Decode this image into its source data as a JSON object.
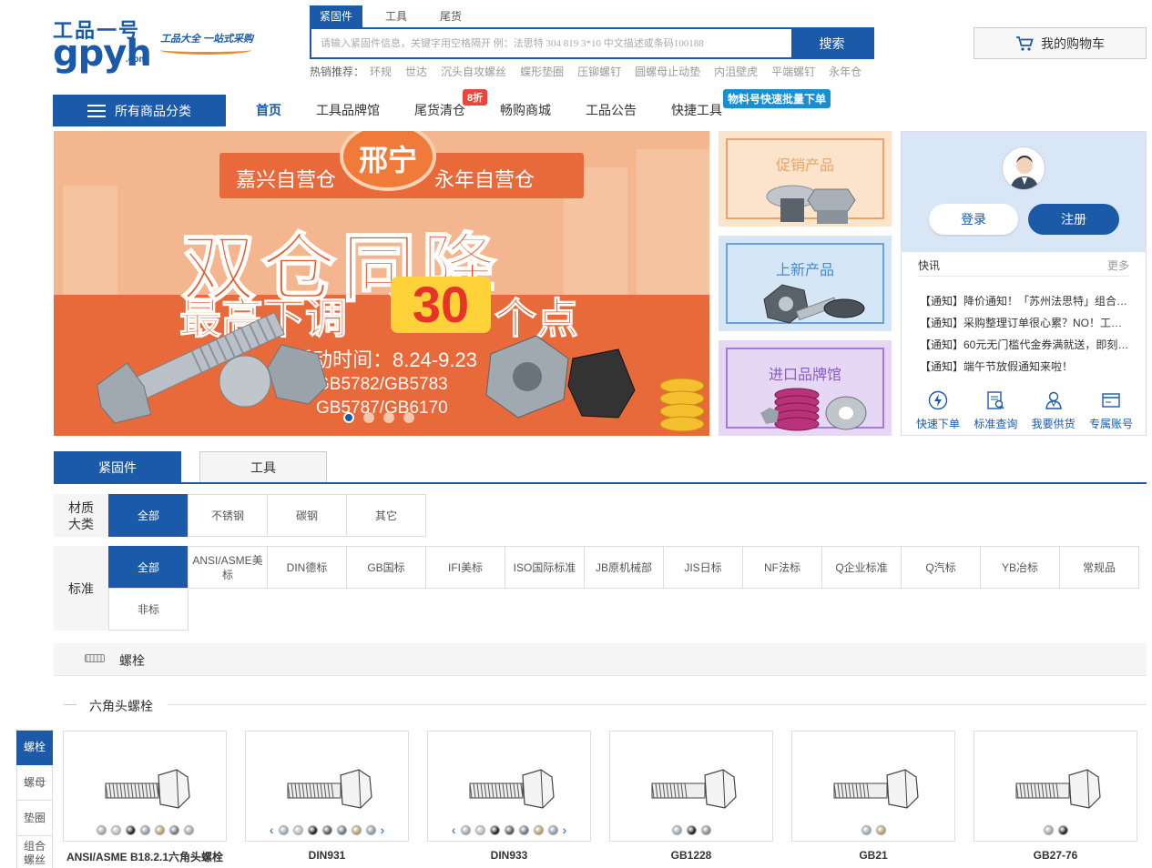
{
  "logo": {
    "cn": "工品一号",
    "en": "gpyh",
    "com": ".com",
    "slogan": "工品大全 一站式采购"
  },
  "search": {
    "tabs": [
      "紧固件",
      "工具",
      "尾货"
    ],
    "active_tab": "紧固件",
    "placeholder": "请输入紧固件信息，关键字用空格隔开 例：法思特 304 819 3*10 中文描述或条码100188",
    "button": "搜索",
    "hot_label": "热销推荐：",
    "hot_items": [
      "环规",
      "世达",
      "沉头自攻螺丝",
      "蝶形垫圈",
      "压铆螺钉",
      "圆螺母止动垫",
      "内沮壁虎",
      "平端螺钉",
      "永年仓"
    ]
  },
  "cart": {
    "label": "我的购物车",
    "icon": "cart-icon"
  },
  "nav": {
    "all_categories": "所有商品分类",
    "items": [
      "首页",
      "工具品牌馆",
      "尾货清仓",
      "畅购商城",
      "工品公告",
      "快捷工具"
    ],
    "active": "首页",
    "badge_discount": "8折",
    "badge_bulk": "物料号快速批量下单"
  },
  "banner": {
    "ribbon_left": "嘉兴自营仓",
    "ribbon_center": "邢宁",
    "ribbon_right": "永年自营仓",
    "title": "双仓同降",
    "sub_prefix": "最高下调",
    "sub_number": "30",
    "sub_suffix": "个点",
    "activity_time": "活动时间：8.24-9.23",
    "standards": [
      "GB5782/GB5783",
      "GB5787/GB6170"
    ],
    "slides": 4,
    "active_slide": 1
  },
  "promos": [
    {
      "title": "促销产品",
      "bg": "#fbe3cc",
      "border": "#e8a46a",
      "color": "#e8a46a"
    },
    {
      "title": "上新产品",
      "bg": "#d5e6f7",
      "border": "#6aa3d8",
      "color": "#4a8ac8"
    },
    {
      "title": "进口品牌馆",
      "bg": "#e6d8f5",
      "border": "#a57ad8",
      "color": "#8a5ac0"
    }
  ],
  "user": {
    "login": "登录",
    "register": "注册",
    "news_title": "快讯",
    "news_more": "更多",
    "news": [
      "【通知】降价通知！「苏州法思特」组合…",
      "【通知】采购整理订单很心累？NO！工…",
      "【通知】60元无门槛代金券满就送，即刻…",
      "【通知】端午节放假通知来啦！"
    ],
    "quick": [
      {
        "label": "快速下单",
        "icon": "lightning-icon"
      },
      {
        "label": "标准查询",
        "icon": "document-search-icon"
      },
      {
        "label": "我要供货",
        "icon": "supplier-icon"
      },
      {
        "label": "专属账号",
        "icon": "account-card-icon"
      }
    ]
  },
  "category_tabs": [
    "紧固件",
    "工具"
  ],
  "category_active": "紧固件",
  "filters": {
    "material_label": "材质大类",
    "material": [
      "全部",
      "不锈钢",
      "碳钢",
      "其它"
    ],
    "standard_label": "标准",
    "standards": [
      "全部",
      "ANSI/ASME美标",
      "DIN德标",
      "GB国标",
      "IFI美标",
      "ISO国际标准",
      "JB原机械部",
      "JIS日标",
      "NF法标",
      "Q企业标准",
      "Q汽标",
      "YB冶标",
      "常规品",
      "非标"
    ]
  },
  "section": {
    "title": "螺栓",
    "subtitle": "六角头螺栓"
  },
  "side_nav": [
    "螺栓",
    "螺母",
    "垫圈",
    "组合螺丝"
  ],
  "products": [
    {
      "name": "ANSI/ASME B18.2.1六角头螺栓",
      "arrows": false,
      "swatches": [
        "#9ab",
        "#bbb",
        "#222",
        "#8899aa",
        "#b8a060",
        "#667788",
        "#a8a8a8"
      ]
    },
    {
      "name": "DIN931",
      "arrows": true,
      "swatches": [
        "#9ab",
        "#bbb",
        "#222",
        "#555",
        "#667788",
        "#b8a060",
        "#8899aa"
      ]
    },
    {
      "name": "DIN933",
      "arrows": true,
      "swatches": [
        "#9ab",
        "#bbb",
        "#222",
        "#555",
        "#667788",
        "#b8a060",
        "#8899aa"
      ]
    },
    {
      "name": "GB1228",
      "arrows": false,
      "swatches": [
        "#9ab",
        "#222",
        "#888"
      ]
    },
    {
      "name": "GB21",
      "arrows": false,
      "swatches": [
        "#9ab",
        "#b8a060"
      ]
    },
    {
      "name": "GB27-76",
      "arrows": false,
      "swatches": [
        "#9ab",
        "#222"
      ]
    }
  ]
}
